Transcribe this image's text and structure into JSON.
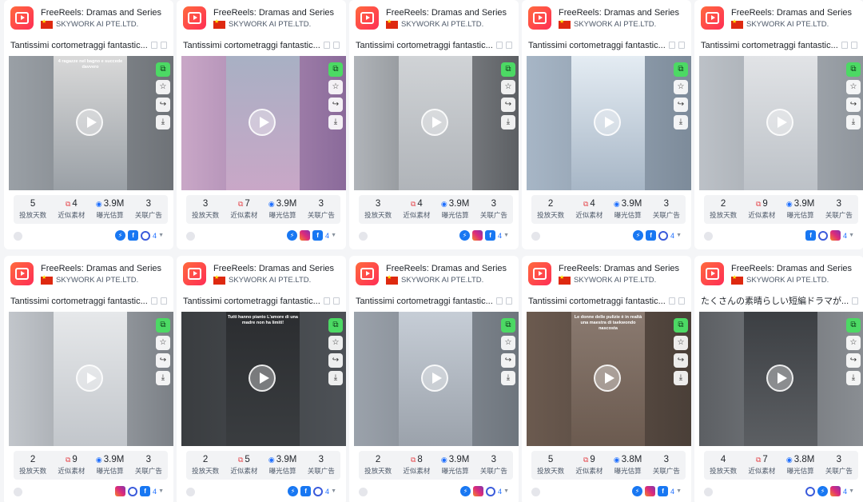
{
  "stat_labels": [
    "投放天数",
    "近似素材",
    "曝光估算",
    "关联广告"
  ],
  "cards": [
    {
      "app": "FreeReels: Dramas and Series",
      "company": "SKYWORK AI PTE.LTD.",
      "title": "Tantissimi cortometraggi fantastic...",
      "caption": "4 ragazze nel bagno e succede davvero",
      "days": "5",
      "similar": "4",
      "exposure": "3.9M",
      "related": "3",
      "platforms": [
        "messenger",
        "facebook",
        "audience"
      ],
      "count": "4",
      "colors": [
        "#9aa0a6",
        "#d9d9d9",
        "#6e7277"
      ]
    },
    {
      "app": "FreeReels: Dramas and Series",
      "company": "SKYWORK AI PTE.LTD.",
      "title": "Tantissimi cortometraggi fantastic...",
      "caption": "",
      "days": "3",
      "similar": "7",
      "exposure": "3.9M",
      "related": "3",
      "platforms": [
        "messenger",
        "instagram",
        "facebook"
      ],
      "count": "4",
      "colors": [
        "#c9a7c7",
        "#a8b0c4",
        "#8a6a9a"
      ]
    },
    {
      "app": "FreeReels: Dramas and Series",
      "company": "SKYWORK AI PTE.LTD.",
      "title": "Tantissimi cortometraggi fantastic...",
      "caption": "",
      "days": "3",
      "similar": "4",
      "exposure": "3.9M",
      "related": "3",
      "platforms": [
        "messenger",
        "instagram",
        "facebook"
      ],
      "count": "4",
      "colors": [
        "#b0b4b9",
        "#d0d3d6",
        "#5c5f63"
      ]
    },
    {
      "app": "FreeReels: Dramas and Series",
      "company": "SKYWORK AI PTE.LTD.",
      "title": "Tantissimi cortometraggi fantastic...",
      "caption": "",
      "days": "2",
      "similar": "4",
      "exposure": "3.9M",
      "related": "3",
      "platforms": [
        "messenger",
        "facebook",
        "audience"
      ],
      "count": "4",
      "colors": [
        "#a7b6c6",
        "#e4ecf3",
        "#7d8b9a"
      ]
    },
    {
      "app": "FreeReels: Dramas and Series",
      "company": "SKYWORK AI PTE.LTD.",
      "title": "Tantissimi cortometraggi fantastic...",
      "caption": "",
      "days": "2",
      "similar": "9",
      "exposure": "3.9M",
      "related": "3",
      "platforms": [
        "facebook",
        "audience",
        "instagram"
      ],
      "count": "4",
      "colors": [
        "#bcc1c7",
        "#e1e3e6",
        "#8f959c"
      ]
    },
    {
      "app": "FreeReels: Dramas and Series",
      "company": "SKYWORK AI PTE.LTD.",
      "title": "Tantissimi cortometraggi fantastic...",
      "caption": "",
      "days": "2",
      "similar": "9",
      "exposure": "3.9M",
      "related": "3",
      "platforms": [
        "instagram",
        "audience",
        "facebook"
      ],
      "count": "4",
      "colors": [
        "#c2c6cb",
        "#e6e8ea",
        "#7b8086"
      ]
    },
    {
      "app": "FreeReels: Dramas and Series",
      "company": "SKYWORK AI PTE.LTD.",
      "title": "Tantissimi cortometraggi fantastic...",
      "caption": "Tutti hanno pianto L'amore di una madre non ha limiti!",
      "days": "2",
      "similar": "5",
      "exposure": "3.9M",
      "related": "3",
      "platforms": [
        "messenger",
        "facebook",
        "audience"
      ],
      "count": "4",
      "colors": [
        "#3a3d40",
        "#2b2d30",
        "#4d5156"
      ]
    },
    {
      "app": "FreeReels: Dramas and Series",
      "company": "SKYWORK AI PTE.LTD.",
      "title": "Tantissimi cortometraggi fantastic...",
      "caption": "",
      "days": "2",
      "similar": "8",
      "exposure": "3.9M",
      "related": "3",
      "platforms": [
        "messenger",
        "instagram",
        "audience"
      ],
      "count": "4",
      "colors": [
        "#9ba2ab",
        "#c6cdd6",
        "#6e757d"
      ]
    },
    {
      "app": "FreeReels: Dramas and Series",
      "company": "SKYWORK AI PTE.LTD.",
      "title": "Tantissimi cortometraggi fantastic...",
      "caption": "Le donne delle pulizie è in realtà una maestra di taekwondo nascosta",
      "days": "5",
      "similar": "9",
      "exposure": "3.8M",
      "related": "3",
      "platforms": [
        "messenger",
        "instagram",
        "facebook"
      ],
      "count": "4",
      "colors": [
        "#6b5a4f",
        "#8a7a70",
        "#4a3f38"
      ]
    },
    {
      "app": "FreeReels: Dramas and Series",
      "company": "SKYWORK AI PTE.LTD.",
      "title": "たくさんの素晴らしい短編ドラマが...",
      "caption": "",
      "days": "4",
      "similar": "7",
      "exposure": "3.8M",
      "related": "3",
      "platforms": [
        "audience",
        "messenger",
        "instagram"
      ],
      "count": "4",
      "colors": [
        "#5c5f63",
        "#3c3f43",
        "#8a8e93"
      ]
    }
  ]
}
